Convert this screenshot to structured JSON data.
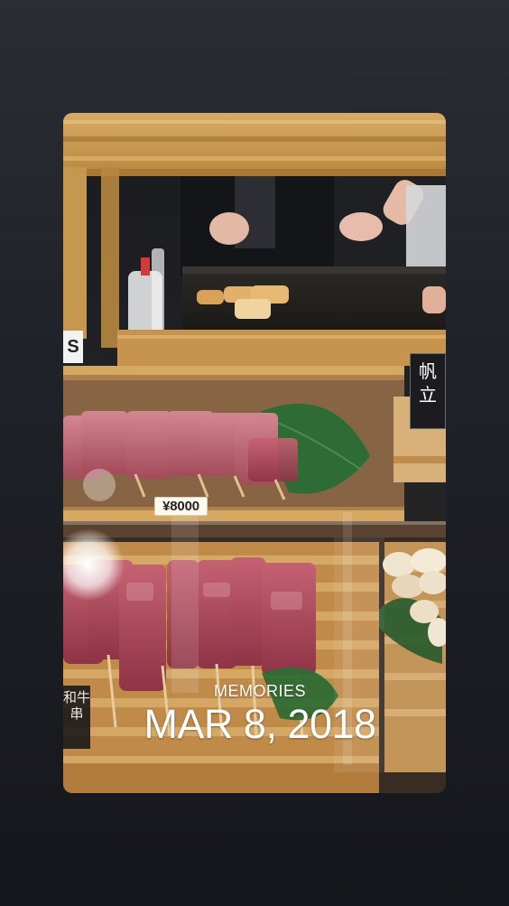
{
  "story": {
    "caption_kicker": "MEMORIES",
    "caption_date": "MAR 8, 2018"
  },
  "photo": {
    "price_tag": "¥8000",
    "edge_letter": "S",
    "sign_right": "帆立",
    "sign_left": "和牛串"
  },
  "colors": {
    "background_top": "#2a2d33",
    "background_bottom": "#15171c",
    "caption_text": "#ffffff",
    "wood": "#c79a55",
    "meat": "#b85a6a"
  }
}
